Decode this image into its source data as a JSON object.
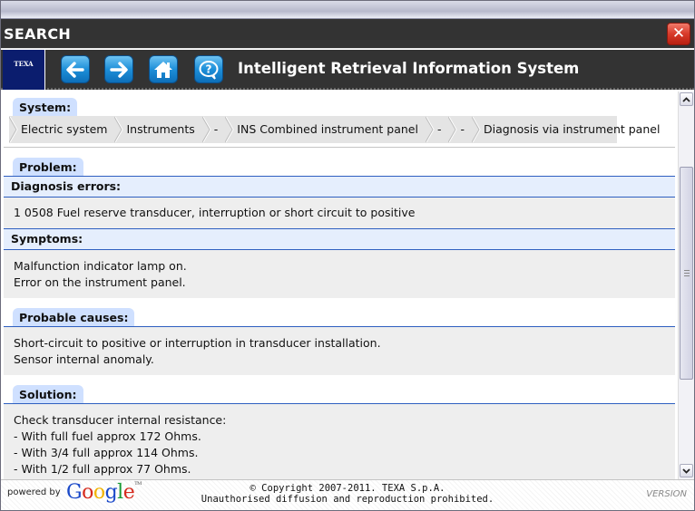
{
  "window": {
    "title": "SEARCH",
    "close_label": "✕"
  },
  "toolbar": {
    "logo_text": "TEXA",
    "app_title": "Intelligent Retrieval Information System",
    "buttons": [
      {
        "name": "back",
        "icon": "arrow-left-icon"
      },
      {
        "name": "forward",
        "icon": "arrow-right-icon"
      },
      {
        "name": "home",
        "icon": "home-icon"
      },
      {
        "name": "help",
        "icon": "help-bubble-icon"
      }
    ]
  },
  "system": {
    "label": "System:",
    "breadcrumb": [
      "Electric system",
      "Instruments",
      "-",
      "INS Combined instrument panel",
      "-",
      "-",
      "Diagnosis via instrument panel"
    ]
  },
  "problem": {
    "label": "Problem:",
    "diagnosis_errors_label": "Diagnosis errors:",
    "diagnosis_errors": [
      "1 0508 Fuel reserve transducer, interruption or short circuit to positive"
    ],
    "symptoms_label": "Symptoms:",
    "symptoms": [
      "Malfunction indicator lamp on.",
      "Error on the instrument panel."
    ]
  },
  "probable_causes": {
    "label": "Probable causes:",
    "lines": [
      "Short-circuit to positive or interruption in transducer installation.",
      "Sensor internal anomaly."
    ]
  },
  "solution": {
    "label": "Solution:",
    "lines": [
      "Check transducer internal resistance:",
      "- With full fuel approx 172 Ohms.",
      "- With 3/4 full approx 114 Ohms.",
      "- With 1/2 full approx 77 Ohms."
    ]
  },
  "footer": {
    "powered_by": "powered by",
    "google": {
      "letters": [
        "G",
        "o",
        "o",
        "g",
        "l",
        "e"
      ],
      "colors": [
        "#1a49c9",
        "#d52b1e",
        "#f2b300",
        "#1a49c9",
        "#199a36",
        "#d52b1e"
      ],
      "tm": "TM"
    },
    "copyright_line1": "© Copyright 2007-2011. TEXA S.p.A.",
    "copyright_line2": "Unauthorised diffusion and reproduction prohibited.",
    "version": "VERSION"
  },
  "scrollbar": {
    "up": "^",
    "down": "v",
    "position_fraction": 0.2
  }
}
